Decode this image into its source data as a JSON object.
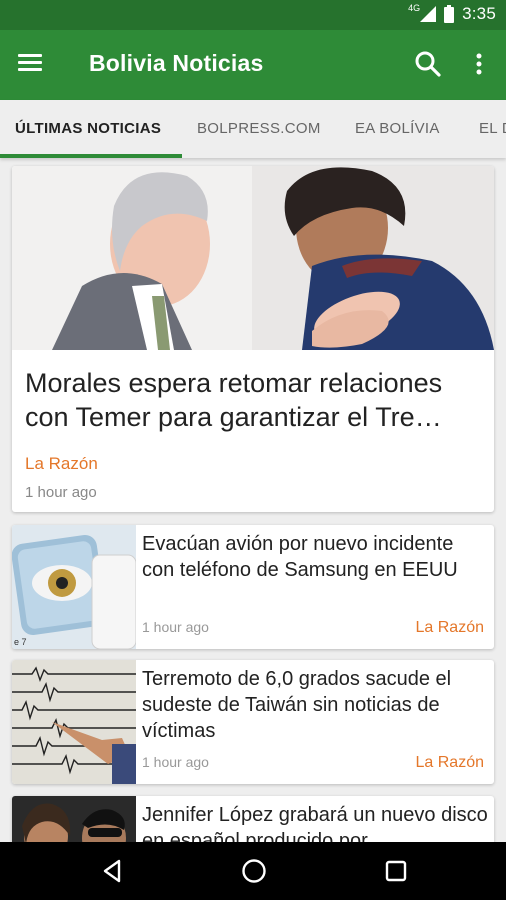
{
  "status_bar": {
    "time": "3:35",
    "network": "4G"
  },
  "app_bar": {
    "title": "Bolivia Noticias"
  },
  "tabs": [
    {
      "label": "ÚLTIMAS NOTICIAS",
      "active": true
    },
    {
      "label": "BOLPRESS.COM",
      "active": false
    },
    {
      "label": "EA BOLÍVIA",
      "active": false
    },
    {
      "label": "EL D",
      "active": false
    }
  ],
  "articles": [
    {
      "title": "Morales espera retomar relaciones con Temer para garantizar el Tre…",
      "source": "La Razón",
      "time": "1 hour ago"
    },
    {
      "title": "Evacúan avión por nuevo incidente con teléfono de Samsung en EEUU",
      "source": "La Razón",
      "time": "1 hour ago"
    },
    {
      "title": "Terremoto de 6,0 grados sacude el sudeste de Taiwán sin noticias de víctimas",
      "source": "La Razón",
      "time": "1 hour ago"
    },
    {
      "title": "Jennifer López grabará un nuevo disco en español producido por",
      "source": "",
      "time": ""
    }
  ],
  "thumb_caption": "e 7",
  "colors": {
    "status": "#26722d",
    "toolbar": "#2e8b37",
    "source": "#e4772a",
    "background": "#eeeeee"
  },
  "icons": [
    "menu-icon",
    "search-icon",
    "more-vert-icon",
    "signal-icon",
    "battery-icon",
    "back-icon",
    "home-icon",
    "recents-icon"
  ]
}
